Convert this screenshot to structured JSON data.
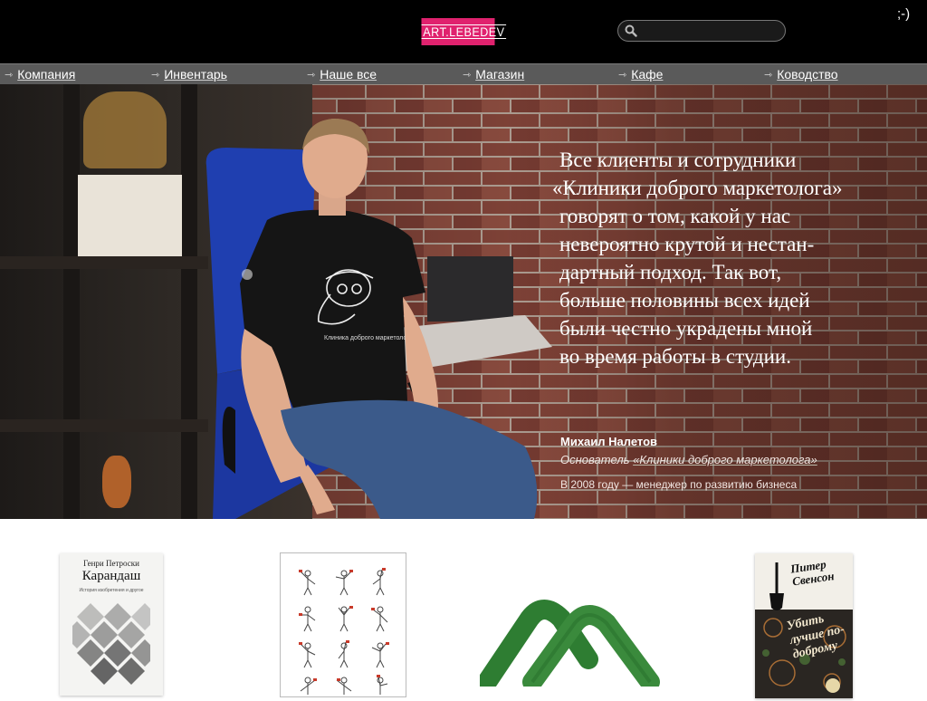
{
  "header": {
    "logo_text": "ART.LEBEDEV",
    "search": {
      "placeholder": "",
      "value": ""
    },
    "smiley": ";-)"
  },
  "nav": {
    "items": [
      {
        "label": "Компания"
      },
      {
        "label": "Инвентарь"
      },
      {
        "label": "Наше все"
      },
      {
        "label": "Магазин"
      },
      {
        "label": "Кафе"
      },
      {
        "label": "Ководство"
      }
    ]
  },
  "hero": {
    "quote_lines": [
      "Все клиенты и сотрудники",
      "«Клиники доброго маркетолога»",
      "говорят о том, какой у нас",
      "невероятно крутой и нестан-",
      "дартный подход. Так вот,",
      "больше половины всех идей",
      "были честно украдены мной",
      "во время работы в студии."
    ],
    "author_name": "Михаил Налетов",
    "author_role_prefix": "Основатель ",
    "author_role_link": "«Клиники доброго маркетолога»",
    "author_past": "В 2008 году — менеджер по развитию бизнеса",
    "tshirt_text": "Клиника доброго маркетолога"
  },
  "products": {
    "book1": {
      "author": "Генри Петроски",
      "title": "Карандаш",
      "subtitle": "История изобретения и другое"
    },
    "book2": {
      "author": "Питер Свенсон",
      "title": "Убить лучше по-доброму"
    }
  },
  "colors": {
    "logo_bg": "#e0226e",
    "topbar_bg": "#000000",
    "nav_bg": "#5a5a5a",
    "logo_mark_green": "#2e7d32"
  }
}
